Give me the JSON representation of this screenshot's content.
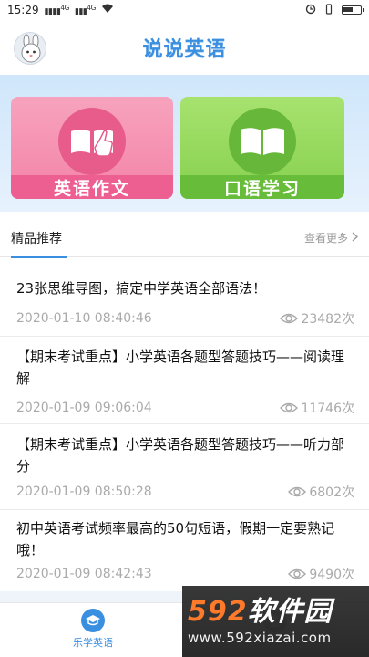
{
  "status_bar": {
    "time": "15:29",
    "signal_1": "4G",
    "signal_2": "4G"
  },
  "header": {
    "title": "说说英语"
  },
  "banners": [
    {
      "label": "英语作文",
      "color": "#f383a8",
      "icon": "book-hand-icon"
    },
    {
      "label": "口语学习",
      "color": "#86d04e",
      "icon": "open-book-icon"
    }
  ],
  "section": {
    "title": "精品推荐",
    "more": "查看更多"
  },
  "articles": [
    {
      "title": "23张思维导图，搞定中学英语全部语法！",
      "date": "2020-01-10 08:40:46",
      "views": "23482次"
    },
    {
      "title": "【期末考试重点】小学英语各题型答题技巧——阅读理解",
      "date": "2020-01-09 09:06:04",
      "views": "11746次"
    },
    {
      "title": "【期末考试重点】小学英语各题型答题技巧——听力部分",
      "date": "2020-01-09 08:50:28",
      "views": "6802次"
    },
    {
      "title": "初中英语考试频率最高的50句短语，假期一定要熟记哦！",
      "date": "2020-01-09 08:42:43",
      "views": "9490次"
    }
  ],
  "tab_bar": {
    "home_label": "乐学英语",
    "mine_label": ""
  },
  "watermark": {
    "num": "592",
    "cn": "软件园",
    "url": "www.592xiazai.com"
  },
  "colors": {
    "accent": "#3b8fe0",
    "essay": "#f383a8",
    "oral": "#86d04e"
  }
}
